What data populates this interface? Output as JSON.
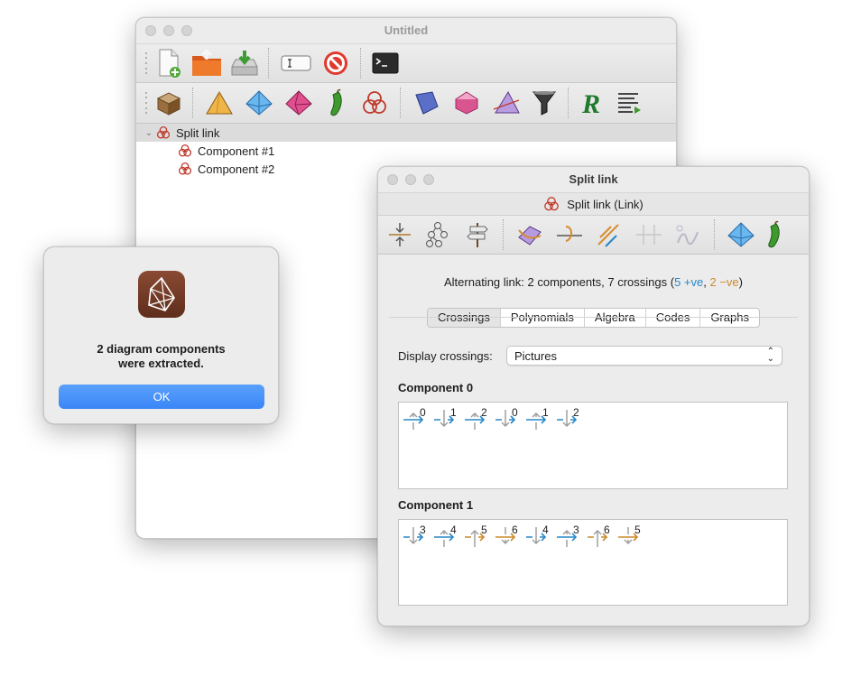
{
  "main_window": {
    "title": "Untitled",
    "toolbar1": [
      {
        "name": "new-document-icon"
      },
      {
        "name": "open-folder-icon"
      },
      {
        "name": "save-drive-icon"
      },
      {
        "name": "text-input-icon"
      },
      {
        "name": "stop-icon"
      },
      {
        "name": "terminal-icon"
      }
    ],
    "toolbar2": [
      {
        "name": "container-box-icon"
      },
      {
        "name": "triangulation-icon"
      },
      {
        "name": "tetrahedron-icon"
      },
      {
        "name": "pink-polyhedron-icon"
      },
      {
        "name": "snappea-icon"
      },
      {
        "name": "knot-icon"
      },
      {
        "name": "normal-surfaces-icon"
      },
      {
        "name": "angle-structures-icon"
      },
      {
        "name": "filled-triangulation-icon"
      },
      {
        "name": "filter-icon"
      },
      {
        "name": "r-script-icon"
      },
      {
        "name": "text-packet-icon"
      }
    ],
    "tree": {
      "root": {
        "label": "Split link",
        "icon": "knot-icon"
      },
      "children": [
        {
          "label": "Component #1",
          "icon": "knot-icon"
        },
        {
          "label": "Component #2",
          "icon": "knot-icon"
        }
      ]
    }
  },
  "alert": {
    "message_line1": "2 diagram components",
    "message_line2": "were extracted.",
    "ok_label": "OK",
    "icon": "regina-app-icon"
  },
  "link_window": {
    "title": "Split link",
    "header": "Split link (Link)",
    "toolbar": [
      {
        "name": "reflect-icon"
      },
      {
        "name": "graph-icon"
      },
      {
        "name": "signpost-icon"
      },
      {
        "name": "rotate-icon"
      },
      {
        "name": "twist-icon"
      },
      {
        "name": "pass-move-icon"
      },
      {
        "name": "disabled-split-icon"
      },
      {
        "name": "disabled-strand-icon"
      },
      {
        "name": "complement-tetra-icon"
      },
      {
        "name": "snappea-icon"
      }
    ],
    "summary_prefix": "Alternating link: 2 components, 7 crossings (",
    "positive": "5 +ve",
    "comma": ", ",
    "negative": "2 −ve",
    "summary_suffix": ")",
    "tabs": [
      "Crossings",
      "Polynomials",
      "Algebra",
      "Codes",
      "Graphs"
    ],
    "active_tab": "Crossings",
    "display_label": "Display crossings:",
    "display_value": "Pictures",
    "components": [
      {
        "label": "Component 0",
        "crossings": [
          {
            "n": "0",
            "kind": "over-up-pos"
          },
          {
            "n": "1",
            "kind": "under-down-pos"
          },
          {
            "n": "2",
            "kind": "over-up-pos"
          },
          {
            "n": "0",
            "kind": "under-down-pos"
          },
          {
            "n": "1",
            "kind": "over-up-pos"
          },
          {
            "n": "2",
            "kind": "under-down-pos"
          }
        ]
      },
      {
        "label": "Component 1",
        "crossings": [
          {
            "n": "3",
            "kind": "under-down-pos"
          },
          {
            "n": "4",
            "kind": "over-up-pos"
          },
          {
            "n": "5",
            "kind": "under-up-neg"
          },
          {
            "n": "6",
            "kind": "over-down-neg"
          },
          {
            "n": "4",
            "kind": "under-down-pos"
          },
          {
            "n": "3",
            "kind": "over-up-pos"
          },
          {
            "n": "6",
            "kind": "under-up-neg"
          },
          {
            "n": "5",
            "kind": "over-down-neg"
          }
        ]
      }
    ]
  },
  "colors": {
    "positive": "#2a87c8",
    "negative": "#cc8a2c",
    "crossing_gray": "#9a9a9a",
    "ok_button": "#3a86f7"
  }
}
